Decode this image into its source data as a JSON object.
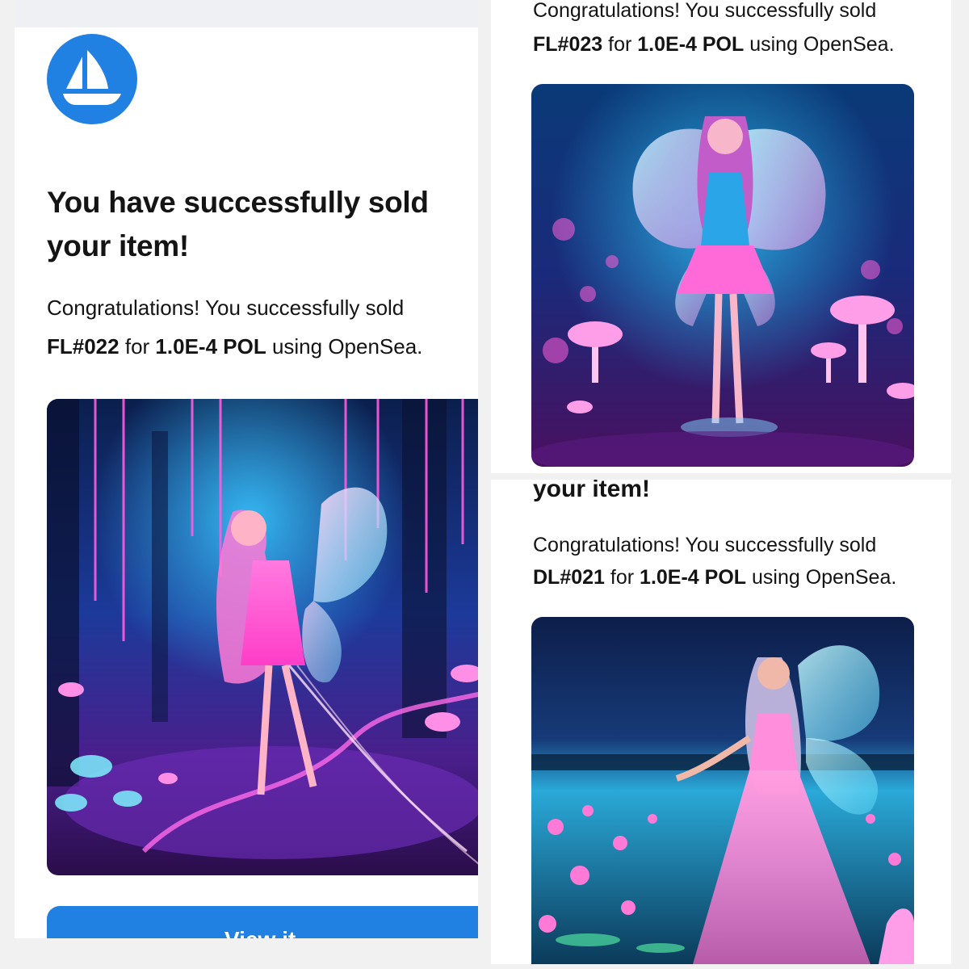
{
  "left_card": {
    "heading": "You have successfully sold your item!",
    "line1": "Congratulations! You successfully sold",
    "item_id": "FL#022",
    "for_text": "for",
    "price": "1.0E-4 POL",
    "using_text": "using OpenSea.",
    "button_label": "View it",
    "logo": "opensea-logo-icon",
    "image": "fairy-forest-artwork-fl022"
  },
  "right_top_card": {
    "cut_line": "Congratulations! You successfully sold",
    "item_id": "FL#023",
    "for_text": "for",
    "price": "1.0E-4 POL",
    "using_text": "using OpenSea.",
    "image": "fairy-mushroom-artwork-fl023"
  },
  "right_bottom_card": {
    "heading_fragment": "your item!",
    "line1": "Congratulations! You successfully sold",
    "item_id": "DL#021",
    "for_text": "for",
    "price": "1.0E-4 POL",
    "using_text": "using OpenSea.",
    "image": "fairy-lotus-artwork-dl021"
  },
  "colors": {
    "brand_blue": "#2081e2",
    "text": "#141414",
    "background": "#f1f1f1"
  }
}
